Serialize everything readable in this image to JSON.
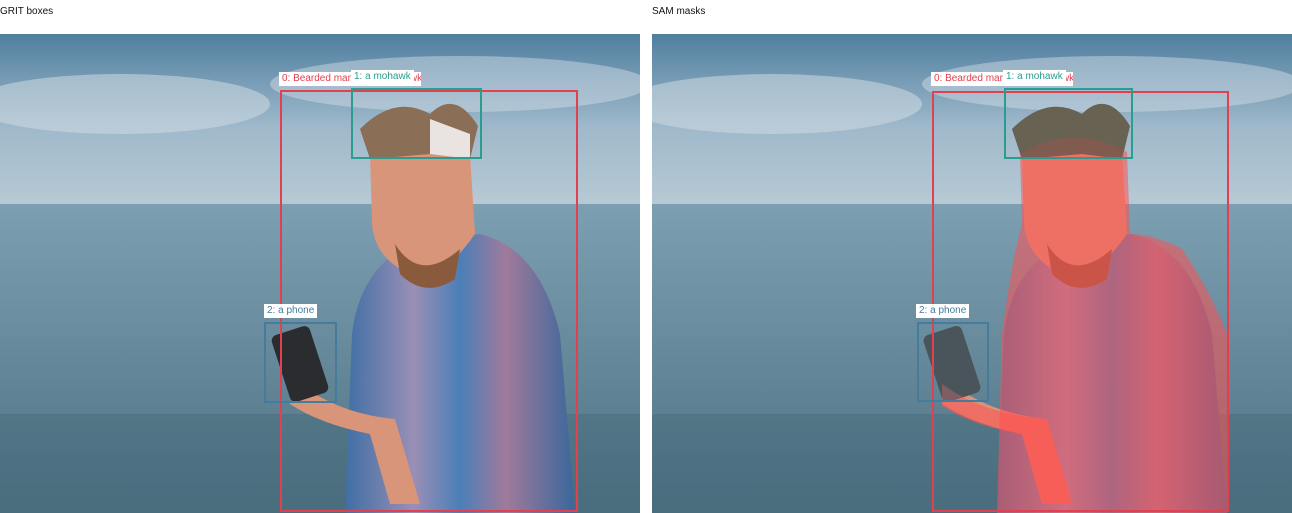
{
  "panels": [
    {
      "title": "GRIT boxes"
    },
    {
      "title": "SAM masks"
    }
  ],
  "detections": [
    {
      "label": "0: Bearded man with a mohawk",
      "color": "#e04050"
    },
    {
      "label": "1: a mohawk",
      "color": "#2a9d8f"
    },
    {
      "label": "2: a phone",
      "color": "#457b9d"
    }
  ],
  "colors": {
    "sky_top": "#5f8fae",
    "sky_bottom": "#a9c2d3",
    "sea": "#6f95a6",
    "mask_person": "#ff5050",
    "mask_hair": "#505a50",
    "mask_phone": "#64787f"
  }
}
